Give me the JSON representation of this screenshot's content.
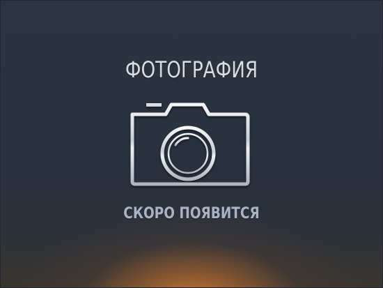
{
  "placeholder": {
    "title": "ФОТОГРАФИЯ",
    "subtitle": "СКОРО ПОЯВИТСЯ",
    "icon": "camera-icon"
  },
  "colors": {
    "background": "#2a323e",
    "glow": "#d68234",
    "title_text": "#d9dde2",
    "subtitle_text": "#aab3c6",
    "icon_stroke": "#e6e9ed"
  }
}
